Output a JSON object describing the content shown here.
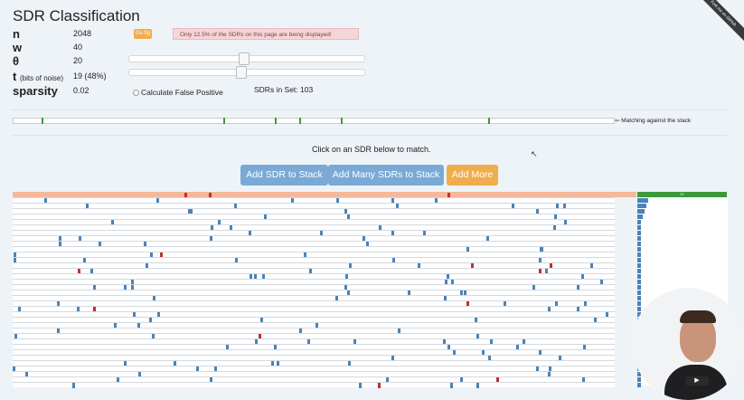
{
  "title": "SDR Classification",
  "params": [
    {
      "label": "n",
      "value": "2048"
    },
    {
      "label": "w",
      "value": "40"
    },
    {
      "label": "θ",
      "value": "20"
    },
    {
      "label": "t",
      "sublabel": "(bits of noise)",
      "value": "19 (48%)"
    },
    {
      "label": "sparsity",
      "value": "0.02"
    }
  ],
  "go_button": "Go fig",
  "alert_text": "Only 12.5% of the SDRs on this page are being displayed!",
  "false_positive_label": "Calculate False Positive",
  "sdrs_in_set": "SDRs in Set: 103",
  "matching_label": "⇦ Matching against the stack",
  "click_hint": "Click on an SDR below to match.",
  "buttons": {
    "add_sdr": "Add SDR to Stack",
    "add_many": "Add Many SDRs to Stack",
    "add_more": "Add More"
  },
  "ribbon_text": "Fork me on GitHub",
  "score_header": "37",
  "play_icon": "▶",
  "colors": {
    "blue": "#4a83b8",
    "red": "#c22f2f",
    "green": "#3a9a3a",
    "orange": "#f0ad4e",
    "button_blue": "#7aa9d6"
  }
}
